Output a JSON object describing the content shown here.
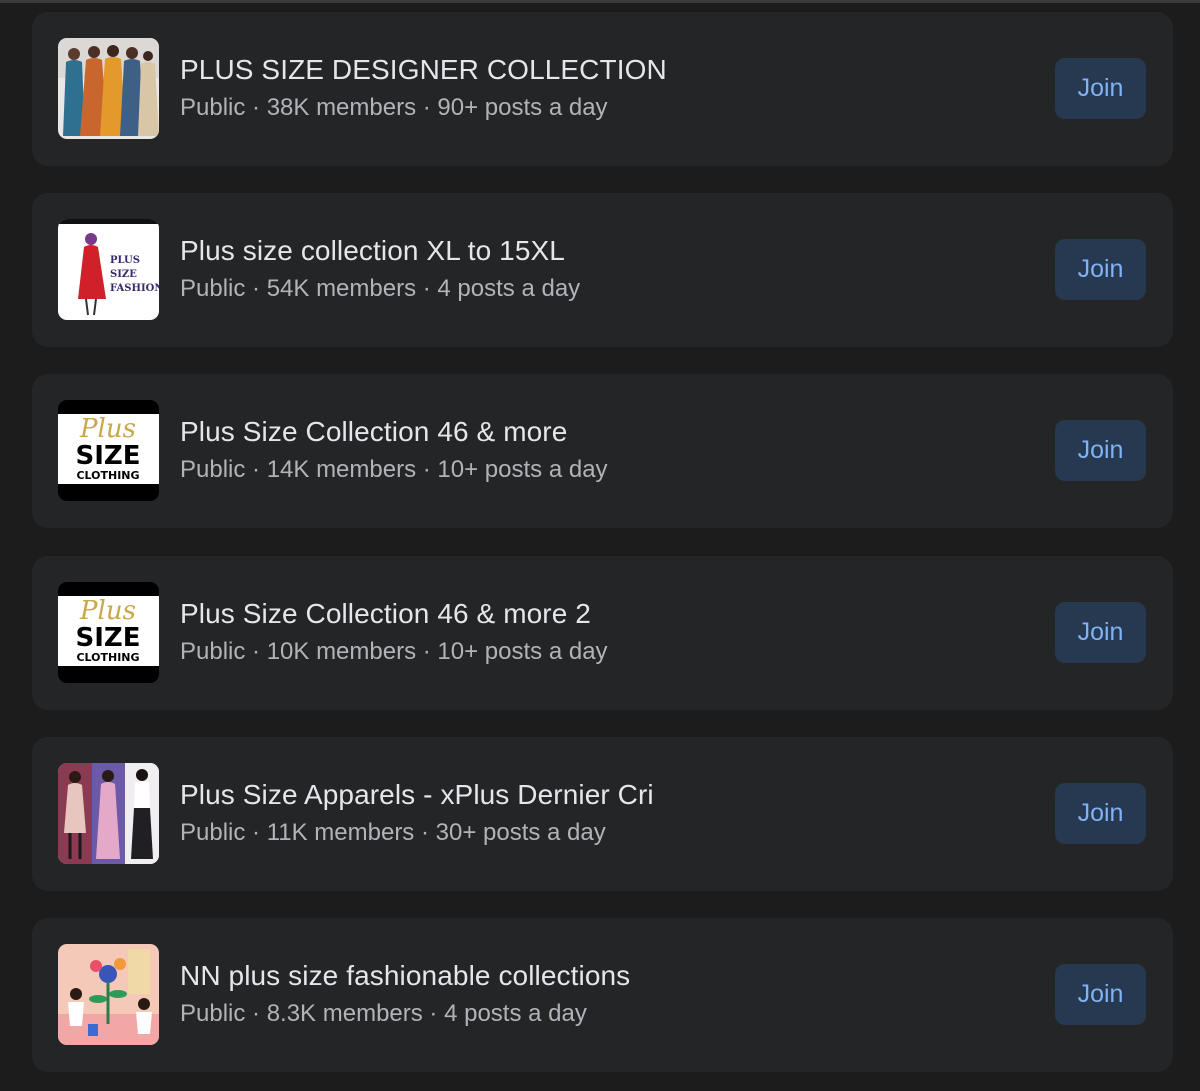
{
  "groups": [
    {
      "name": "PLUS SIZE DESIGNER COLLECTION",
      "meta": "Public · 38K members · 90+ posts a day",
      "join_label": "Join",
      "thumb": "women-in-gowns-photo"
    },
    {
      "name": "Plus size collection XL to 15XL",
      "meta": "Public · 54K members · 4 posts a day",
      "join_label": "Join",
      "thumb": "plus-size-fashion-logo",
      "thumb_text": [
        "PLUS",
        "SIZE",
        "FASHION"
      ]
    },
    {
      "name": "Plus Size Collection 46 & more",
      "meta": "Public · 14K members · 10+ posts a day",
      "join_label": "Join",
      "thumb": "plus-size-clothing-logo",
      "thumb_text": [
        "Plus",
        "SIZE",
        "CLOTHING"
      ]
    },
    {
      "name": "Plus Size Collection 46 & more 2",
      "meta": "Public · 10K members · 10+ posts a day",
      "join_label": "Join",
      "thumb": "plus-size-clothing-logo",
      "thumb_text": [
        "Plus",
        "SIZE",
        "CLOTHING"
      ]
    },
    {
      "name": "Plus Size Apparels - xPlus Dernier Cri",
      "meta": "Public · 11K members · 30+ posts a day",
      "join_label": "Join",
      "thumb": "three-models-photo"
    },
    {
      "name": "NN plus size fashionable collections",
      "meta": "Public · 8.3K members · 4 posts a day",
      "join_label": "Join",
      "thumb": "illustration-people-plants"
    }
  ],
  "colors": {
    "background": "#1c1c1d",
    "card": "#242526",
    "title_text": "#e4e6eb",
    "meta_text": "#b0b3b8",
    "join_button_bg": "#263951",
    "join_button_text": "#7fb3f5"
  }
}
